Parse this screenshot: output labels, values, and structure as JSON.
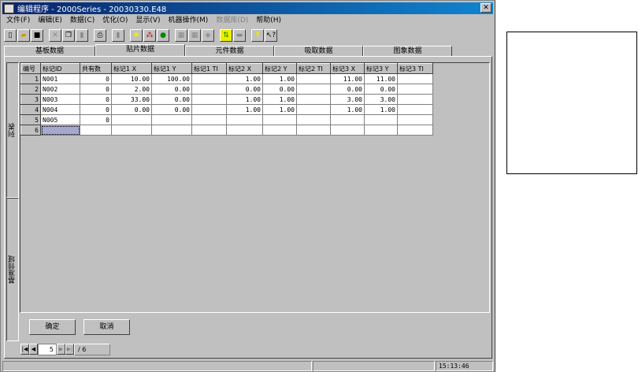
{
  "window": {
    "title": "编辑程序 - 2000Series - 20030330.E48"
  },
  "menu": [
    "文件(F)",
    "编辑(E)",
    "数据(C)",
    "优化(O)",
    "显示(V)",
    "机器操作(M)",
    "数据库(D)",
    "帮助(H)"
  ],
  "tabs": [
    "基板数据",
    "贴片数据",
    "元件数据",
    "吸取数据",
    "图象数据"
  ],
  "side_tabs": [
    "列表",
    "基准领域"
  ],
  "table": {
    "headers": [
      "编号",
      "标记ID",
      "共有数",
      "标记1 X",
      "标记1 Y",
      "标记1 TI",
      "标记2 X",
      "标记2 Y",
      "标记2 TI",
      "标记3 X",
      "标记3 Y",
      "标记3 TI"
    ],
    "rows": [
      [
        "1",
        "N001",
        "0",
        "10.00",
        "100.00",
        "",
        "1.00",
        "1.00",
        "",
        "11.00",
        "11.00",
        ""
      ],
      [
        "2",
        "N002",
        "0",
        "2.00",
        "0.00",
        "",
        "0.00",
        "0.00",
        "",
        "0.00",
        "0.00",
        ""
      ],
      [
        "3",
        "N003",
        "0",
        "33.00",
        "0.00",
        "",
        "1.00",
        "1.00",
        "",
        "3.00",
        "3.00",
        ""
      ],
      [
        "4",
        "N004",
        "0",
        "0.00",
        "0.00",
        "",
        "1.00",
        "1.00",
        "",
        "1.00",
        "1.00",
        ""
      ],
      [
        "5",
        "N005",
        "0",
        "",
        "",
        "",
        "",
        "",
        "",
        "",
        "",
        ""
      ],
      [
        "6",
        "",
        "",
        "",
        "",
        "",
        "",
        "",
        "",
        "",
        "",
        ""
      ]
    ]
  },
  "buttons": {
    "ok": "确定",
    "cancel": "取消"
  },
  "nav": {
    "current": "5",
    "total": "/ 6"
  },
  "status": {
    "time": "15:13:46"
  }
}
